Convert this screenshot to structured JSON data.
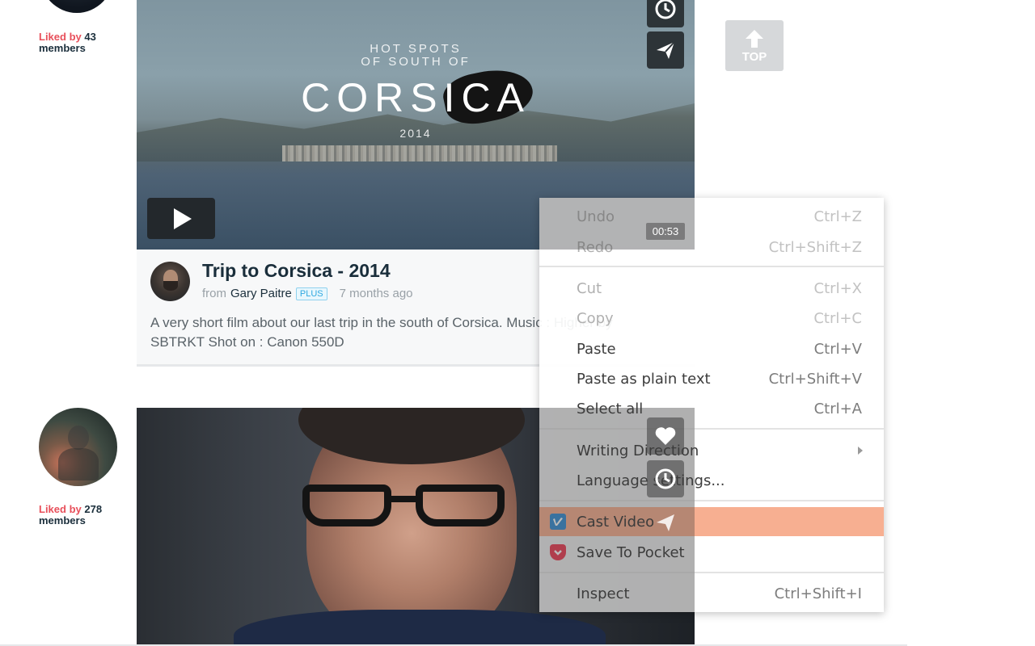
{
  "feed": {
    "item1": {
      "likes_prefix": "Liked by",
      "likes_count": "43",
      "likes_suffix": "members",
      "video": {
        "overlay_line1": "HOT SPOTS",
        "overlay_line2": "OF SOUTH OF",
        "overlay_title": "CORSICA",
        "overlay_year": "2014"
      },
      "title": "Trip to Corsica - 2014",
      "from_label": "from",
      "author": "Gary Paitre",
      "badge": "PLUS",
      "age": "7 months ago",
      "description": "A very short film about our last trip in the south of Corsica. Music : Higher by SBTRKT Shot on : Canon 550D",
      "duration": "00:53"
    },
    "item2": {
      "likes_prefix": "Liked by",
      "likes_count": "278",
      "likes_suffix": "members"
    }
  },
  "top_button": {
    "label": "TOP"
  },
  "context_menu": {
    "items": [
      {
        "label": "Undo",
        "shortcut": "Ctrl+Z",
        "enabled": false
      },
      {
        "label": "Redo",
        "shortcut": "Ctrl+Shift+Z",
        "enabled": false
      },
      {
        "label": "Cut",
        "shortcut": "Ctrl+X",
        "enabled": false
      },
      {
        "label": "Copy",
        "shortcut": "Ctrl+C",
        "enabled": false
      },
      {
        "label": "Paste",
        "shortcut": "Ctrl+V",
        "enabled": true
      },
      {
        "label": "Paste as plain text",
        "shortcut": "Ctrl+Shift+V",
        "enabled": true
      },
      {
        "label": "Select all",
        "shortcut": "Ctrl+A",
        "enabled": true
      },
      {
        "label": "Writing Direction",
        "shortcut": "",
        "enabled": true,
        "submenu": true
      },
      {
        "label": "Language settings...",
        "shortcut": "",
        "enabled": true
      },
      {
        "label": "Cast Video",
        "shortcut": "",
        "enabled": true,
        "highlighted": true,
        "icon": "vimeo-v-icon"
      },
      {
        "label": "Save To Pocket",
        "shortcut": "",
        "enabled": true,
        "icon": "pocket-icon"
      },
      {
        "label": "Inspect",
        "shortcut": "Ctrl+Shift+I",
        "enabled": true
      }
    ]
  },
  "colors": {
    "accent_red": "#e8505b",
    "highlight": "#f7af91",
    "plus_blue": "#2fa8e0",
    "pocket_red": "#ef4056",
    "vimeo_blue": "#3a8fd4"
  }
}
